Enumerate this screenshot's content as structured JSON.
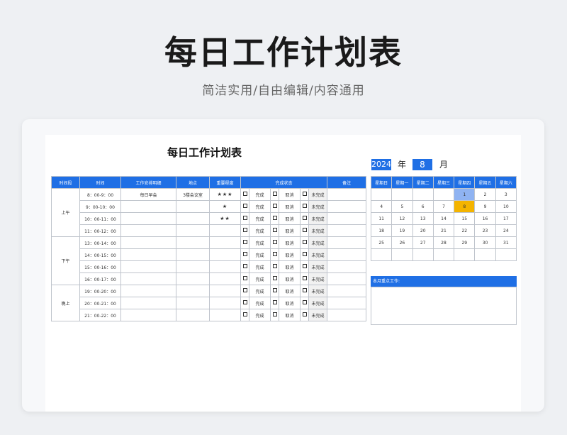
{
  "header": {
    "title": "每日工作计划表",
    "subtitle": "简洁实用/自由编辑/内容通用"
  },
  "sheet": {
    "title": "每日工作计划表",
    "year": "2024",
    "year_label": "年",
    "month": "8",
    "month_label": "月"
  },
  "schedule": {
    "columns": [
      "时间段",
      "时间",
      "工作安排明细",
      "地点",
      "重要程度",
      "完成状态",
      "备注"
    ],
    "status_labels": {
      "done": "完成",
      "cancel": "取消",
      "pending": "未完成"
    },
    "periods": [
      {
        "name": "上午",
        "rows": [
          {
            "time": "8：00-9：00",
            "task": "每日早会",
            "place": "3楼会议室",
            "stars": "★★★"
          },
          {
            "time": "9：00-10：00",
            "task": "",
            "place": "",
            "stars": "★"
          },
          {
            "time": "10：00-11：00",
            "task": "",
            "place": "",
            "stars": "★★"
          },
          {
            "time": "11：00-12：00",
            "task": "",
            "place": "",
            "stars": ""
          }
        ]
      },
      {
        "name": "下午",
        "rows": [
          {
            "time": "13：00-14：00",
            "task": "",
            "place": "",
            "stars": ""
          },
          {
            "time": "14：00-15：00",
            "task": "",
            "place": "",
            "stars": ""
          },
          {
            "time": "15：00-16：00",
            "task": "",
            "place": "",
            "stars": ""
          },
          {
            "time": "16：00-17：00",
            "task": "",
            "place": "",
            "stars": ""
          }
        ]
      },
      {
        "name": "晚上",
        "rows": [
          {
            "time": "19：00-20：00",
            "task": "",
            "place": "",
            "stars": ""
          },
          {
            "time": "20：00-21：00",
            "task": "",
            "place": "",
            "stars": ""
          },
          {
            "time": "21：00-22：00",
            "task": "",
            "place": "",
            "stars": ""
          }
        ]
      }
    ]
  },
  "calendar": {
    "weekdays": [
      "星期日",
      "星期一",
      "星期二",
      "星期三",
      "星期四",
      "星期五",
      "星期六"
    ],
    "weeks": [
      [
        "",
        "",
        "",
        "",
        "1",
        "2",
        "3"
      ],
      [
        "4",
        "5",
        "6",
        "7",
        "8",
        "9",
        "10"
      ],
      [
        "11",
        "12",
        "13",
        "14",
        "15",
        "16",
        "17"
      ],
      [
        "18",
        "19",
        "20",
        "21",
        "22",
        "23",
        "24"
      ],
      [
        "25",
        "26",
        "27",
        "28",
        "29",
        "30",
        "31"
      ],
      [
        "",
        "",
        "",
        "",
        "",
        "",
        ""
      ]
    ],
    "highlight_blue": "1",
    "highlight_yellow": "8",
    "colors": {
      "header": "#1f6fe5",
      "blue": "#8fb3f2",
      "yellow": "#f4b400"
    }
  },
  "focus": {
    "label": "本月重点工作:"
  }
}
